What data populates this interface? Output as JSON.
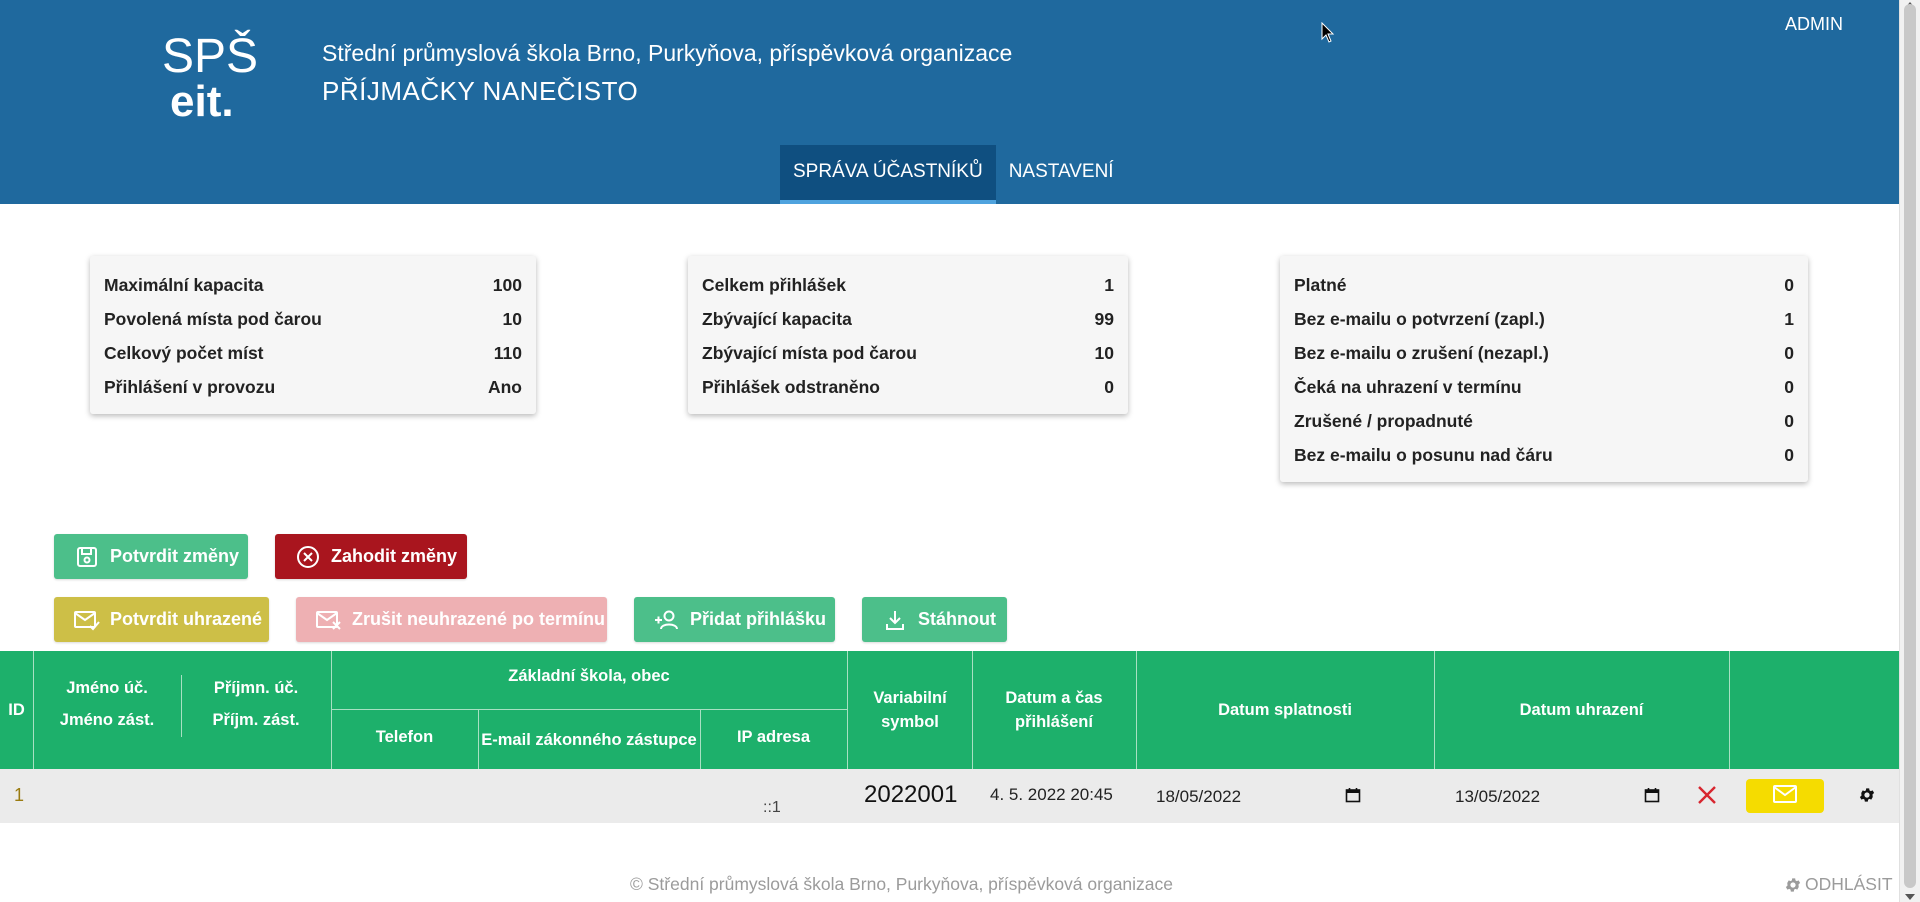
{
  "header": {
    "logo_top": "SPŠ",
    "logo_bottom": "eit.",
    "school_name": "Střední průmyslová škola Brno, Purkyňova, příspěvková organizace",
    "app_title": "PŘÍJMAČKY NANEČISTO",
    "user": "ADMIN",
    "nav": [
      {
        "label": "SPRÁVA ÚČASTNÍKŮ",
        "active": true
      },
      {
        "label": "NASTAVENÍ",
        "active": false
      }
    ]
  },
  "stats": {
    "card1": [
      {
        "label": "Maximální kapacita",
        "value": "100"
      },
      {
        "label": "Povolená místa pod čarou",
        "value": "10"
      },
      {
        "label": "Celkový počet míst",
        "value": "110"
      },
      {
        "label": "Přihlášení v provozu",
        "value": "Ano"
      }
    ],
    "card2": [
      {
        "label": "Celkem přihlášek",
        "value": "1"
      },
      {
        "label": "Zbývající kapacita",
        "value": "99"
      },
      {
        "label": "Zbývající místa pod čarou",
        "value": "10"
      },
      {
        "label": "Přihlášek odstraněno",
        "value": "0"
      }
    ],
    "card3": [
      {
        "label": "Platné",
        "value": "0"
      },
      {
        "label": "Bez e-mailu o potvrzení (zapl.)",
        "value": "1"
      },
      {
        "label": "Bez e-mailu o zrušení (nezapl.)",
        "value": "0"
      },
      {
        "label": "Čeká na uhrazení v termínu",
        "value": "0"
      },
      {
        "label": "Zrušené / propadnuté",
        "value": "0"
      },
      {
        "label": "Bez e-mailu o posunu nad čáru",
        "value": "0"
      }
    ]
  },
  "actions": {
    "confirm_changes": "Potvrdit změny",
    "discard_changes": "Zahodit změny",
    "confirm_paid": "Potvrdit uhrazené",
    "cancel_unpaid": "Zrušit neuhrazené po termínu",
    "add_application": "Přidat přihlášku",
    "download": "Stáhnout"
  },
  "table": {
    "headers": {
      "id": "ID",
      "first_name": "Jméno úč.",
      "last_name": "Příjmn. úč.",
      "school": "Základní škola, obec",
      "guardian_first": "Jméno zást.",
      "guardian_last": "Příjm. zást.",
      "phone": "Telefon",
      "guardian_email": "E-mail zákonného zástupce",
      "ip": "IP adresa",
      "var_symbol": "Variabilní symbol",
      "registered_at": "Datum a čas přihlášení",
      "due_date": "Datum splatnosti",
      "paid_date": "Datum uhrazení"
    },
    "rows": [
      {
        "id": "1",
        "ip": "::1",
        "var_symbol": "2022001",
        "registered_at": "4. 5. 2022 20:45",
        "due_date": "18/05/2022",
        "paid_date": "13/05/2022"
      }
    ]
  },
  "footer": {
    "copyright": "© Střední průmyslová škola Brno, Purkyňova, příspěvková organizace",
    "logout": "ODHLÁSIT"
  },
  "colors": {
    "header_bg": "#1f699e",
    "table_header_bg": "#1db06b",
    "green_button": "#4cbf8a",
    "red_button": "#a9151e",
    "olive_button": "#cdbf47",
    "pink_button": "#eeb0b3",
    "mail_button": "#f5dc00"
  },
  "icons": [
    "save-icon",
    "close-circle-icon",
    "mail-check-icon",
    "mail-cancel-icon",
    "person-add-icon",
    "download-icon",
    "calendar-icon",
    "close-icon",
    "mail-icon",
    "gear-icon",
    "mouse-cursor-icon"
  ]
}
